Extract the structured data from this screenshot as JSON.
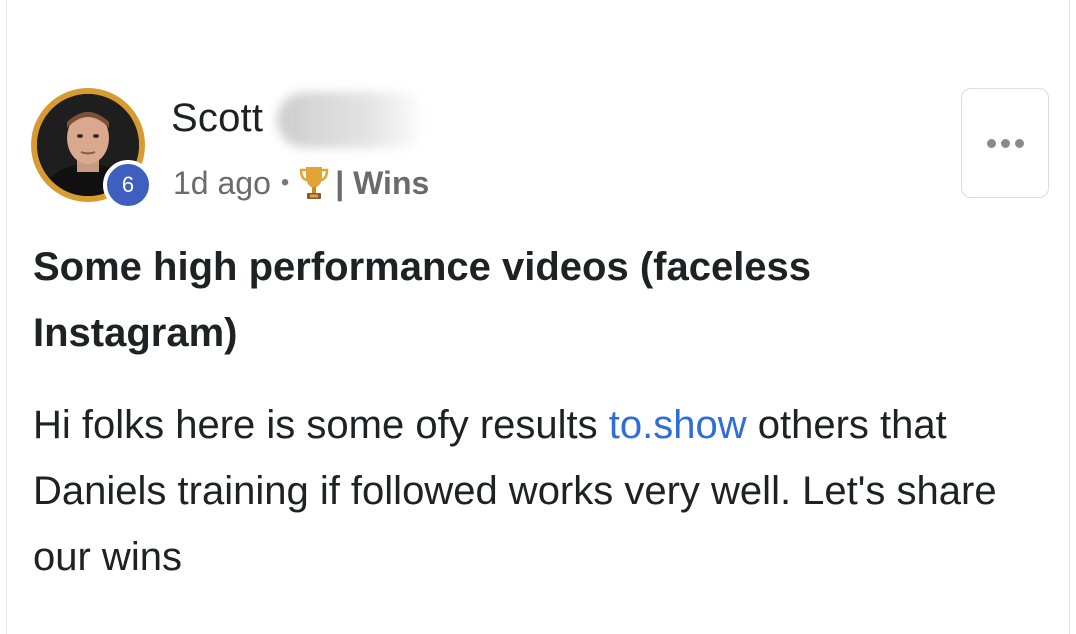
{
  "post": {
    "author": {
      "name": "Scott",
      "level": "6",
      "avatar_icon": "profile-photo"
    },
    "meta": {
      "time": "1d ago",
      "separator": "•",
      "category_icon": "trophy-icon",
      "category": "| Wins"
    },
    "more_icon": "more-horizontal-icon",
    "title": "Some high performance videos (faceless Instagram)",
    "body": {
      "part1": "Hi folks here is some ofy results ",
      "link_text": "to.show",
      "part2": " others that Daniels training if followed works very well. Let's share our wins"
    }
  },
  "colors": {
    "link": "#2f6ed8",
    "badge": "#3f5fbf",
    "avatar_ring": "#d79b32",
    "meta_text": "#6b6b6b"
  }
}
